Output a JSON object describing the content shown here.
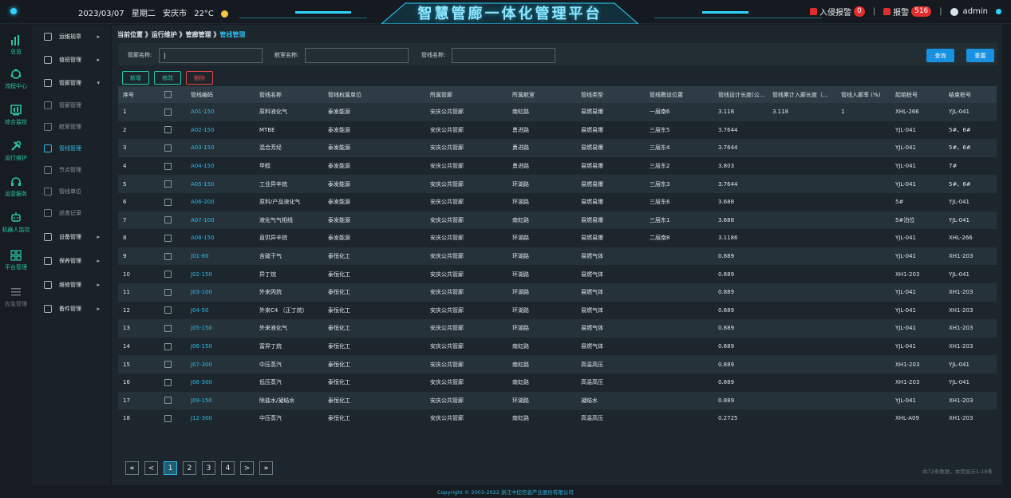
{
  "header": {
    "date": "2023/03/07",
    "weekday": "星期二",
    "city": "安庆市",
    "temperature": "22°C",
    "title": "智慧管廊一体化管理平台",
    "intrusion_label": "入侵报警",
    "intrusion_count": "0",
    "alarm_label": "报警",
    "alarm_count": "516",
    "user": "admin"
  },
  "rail": [
    {
      "label": "总览",
      "icon": "bar-chart-icon"
    },
    {
      "label": "流程中心",
      "icon": "flow-icon"
    },
    {
      "label": "综合监控",
      "icon": "monitor-icon"
    },
    {
      "label": "运行维护",
      "icon": "wrench-icon"
    },
    {
      "label": "运营服务",
      "icon": "headset-icon"
    },
    {
      "label": "机器人监控",
      "icon": "robot-icon"
    },
    {
      "label": "平台管理",
      "icon": "grid-icon"
    },
    {
      "label": "应急管理",
      "icon": "list-icon"
    }
  ],
  "menu": [
    {
      "label": "运维规章",
      "type": "group",
      "arrow": "▸"
    },
    {
      "label": "值班管理",
      "type": "group",
      "arrow": "▸"
    },
    {
      "label": "管廊管理",
      "type": "group",
      "arrow": "▾"
    },
    {
      "label": "管廊管理",
      "type": "sub"
    },
    {
      "label": "舱室管理",
      "type": "sub"
    },
    {
      "label": "管线管理",
      "type": "sub-active"
    },
    {
      "label": "节点管理",
      "type": "sub"
    },
    {
      "label": "管线单位",
      "type": "sub"
    },
    {
      "label": "巡查记录",
      "type": "sub"
    },
    {
      "label": "设备管理",
      "type": "group",
      "arrow": "▸"
    },
    {
      "label": "保养管理",
      "type": "group",
      "arrow": "▸"
    },
    {
      "label": "维修管理",
      "type": "group",
      "arrow": "▸"
    },
    {
      "label": "备件管理",
      "type": "group",
      "arrow": "▸"
    }
  ],
  "breadcrumb": {
    "path": "当前位置 》运行维护 》管廊管理 》",
    "current": "管线管理"
  },
  "search": {
    "corridor_label": "管廊名称:",
    "corridor_value": "|",
    "cabin_label": "舱室名称:",
    "cabin_value": "",
    "pipeline_label": "管线名称:",
    "pipeline_value": "",
    "query_button": "查询",
    "reset_button": "重置"
  },
  "actions": {
    "add": "新增",
    "edit": "修改",
    "delete": "删除"
  },
  "table": {
    "columns": [
      "序号",
      "",
      "管线编码",
      "管线名称",
      "管线权属单位",
      "所属管廊",
      "所属舱室",
      "管线类型",
      "管线敷设位置",
      "管线设计长度(公...",
      "管线累计入廊长度（...",
      "管线入廊率 (%)",
      "起始桩号",
      "结束桩号"
    ],
    "rows": [
      [
        "1",
        "A01-150",
        "原料液化气",
        "泰发能源",
        "安庆公共管廊",
        "南虹路",
        "易燃易爆",
        "一层南6",
        "3.118",
        "3.118",
        "1",
        "XHL-266",
        "YJL-041"
      ],
      [
        "2",
        "A02-150",
        "MTBE",
        "泰发能源",
        "安庆公共管廊",
        "勇进路",
        "易燃易爆",
        "三层东5",
        "3.7644",
        "",
        "",
        "YJL-041",
        "5#、6#"
      ],
      [
        "3",
        "A03-150",
        "混合芳烃",
        "泰发能源",
        "安庆公共管廊",
        "勇进路",
        "易燃易爆",
        "三层东4",
        "3.7644",
        "",
        "",
        "YJL-041",
        "5#、6#"
      ],
      [
        "4",
        "A04-150",
        "甲醇",
        "泰发能源",
        "安庆公共管廊",
        "勇进路",
        "易燃易爆",
        "三层东2",
        "3.803",
        "",
        "",
        "YJL-041",
        "7#"
      ],
      [
        "5",
        "A05-150",
        "工业异辛烷",
        "泰发能源",
        "安庆公共管廊",
        "环湖路",
        "易燃易爆",
        "三层东3",
        "3.7644",
        "",
        "",
        "YJL-041",
        "5#、6#"
      ],
      [
        "6",
        "A06-200",
        "原料/产品液化气",
        "泰发能源",
        "安庆公共管廊",
        "环湖路",
        "易燃易爆",
        "三层东6",
        "3.688",
        "",
        "",
        "5#",
        "YJL-041"
      ],
      [
        "7",
        "A07-100",
        "液化气气相线",
        "泰发能源",
        "安庆公共管廊",
        "南虹路",
        "易燃易爆",
        "三层东1",
        "3.688",
        "",
        "",
        "5#泊位",
        "YJL-041"
      ],
      [
        "8",
        "A08-150",
        "直供异辛烷",
        "泰发能源",
        "安庆公共管廊",
        "环湖路",
        "易燃易爆",
        "二层南8",
        "3.1186",
        "",
        "",
        "YJL-041",
        "XHL-266"
      ],
      [
        "9",
        "J01-80",
        "含硫干气",
        "泰恒化工",
        "安庆公共管廊",
        "环湖路",
        "易燃气体",
        "",
        "0.889",
        "",
        "",
        "YJL-041",
        "XH1-203"
      ],
      [
        "10",
        "J02-150",
        "异丁烷",
        "泰恒化工",
        "安庆公共管廊",
        "环湖路",
        "易燃气体",
        "",
        "0.889",
        "",
        "",
        "XH1-203",
        "YJL-041"
      ],
      [
        "11",
        "J03-100",
        "外来丙烷",
        "泰恒化工",
        "安庆公共管廊",
        "环湖路",
        "易燃气体",
        "",
        "0.889",
        "",
        "",
        "YJL-041",
        "XH1-203"
      ],
      [
        "12",
        "J04-50",
        "外来C4 （正丁烷）",
        "泰恒化工",
        "安庆公共管廊",
        "环湖路",
        "易燃气体",
        "",
        "0.889",
        "",
        "",
        "YJL-041",
        "XH1-203"
      ],
      [
        "13",
        "J05-150",
        "外来液化气",
        "泰恒化工",
        "安庆公共管廊",
        "环湖路",
        "易燃气体",
        "",
        "0.889",
        "",
        "",
        "YJL-041",
        "XH1-203"
      ],
      [
        "14",
        "J06-150",
        "富异丁烷",
        "泰恒化工",
        "安庆公共管廊",
        "南虹路",
        "易燃气体",
        "",
        "0.889",
        "",
        "",
        "YJL-041",
        "XH1-203"
      ],
      [
        "15",
        "J07-300",
        "中压蒸汽",
        "泰恒化工",
        "安庆公共管廊",
        "南虹路",
        "高温高压",
        "",
        "0.889",
        "",
        "",
        "XH1-203",
        "YJL-041"
      ],
      [
        "16",
        "J08-300",
        "低压蒸汽",
        "泰恒化工",
        "安庆公共管廊",
        "南虹路",
        "高温高压",
        "",
        "0.889",
        "",
        "",
        "XH1-203",
        "YJL-041"
      ],
      [
        "17",
        "J09-150",
        "除盐水/凝结水",
        "泰恒化工",
        "安庆公共管廊",
        "环湖路",
        "凝结水",
        "",
        "0.889",
        "",
        "",
        "YJL-041",
        "XH1-203"
      ],
      [
        "18",
        "J12-300",
        "中压蒸汽",
        "泰恒化工",
        "安庆公共管廊",
        "南虹路",
        "高温高压",
        "",
        "0.2725",
        "",
        "",
        "XHL-A09",
        "XH1-203"
      ]
    ]
  },
  "pagination": {
    "first": "«",
    "prev": "<",
    "pages": [
      "1",
      "2",
      "3",
      "4"
    ],
    "next": ">",
    "last": "»",
    "info": "共72条数据，本页显示1-18条"
  },
  "footer": "Copyright © 2003-2022 浙江中控信息产业股份有限公司"
}
